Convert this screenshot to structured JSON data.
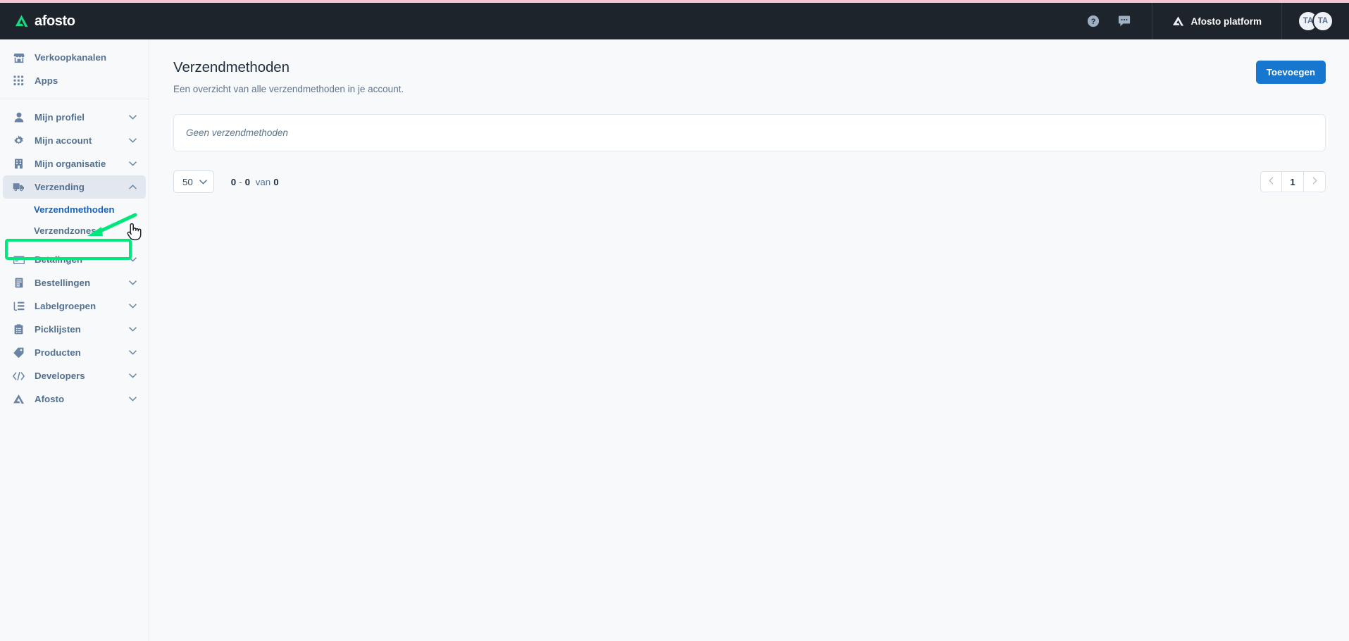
{
  "brand": {
    "name": "afosto",
    "logo_icon": "afosto-triangle-logo"
  },
  "header": {
    "help_icon": "question-circle-icon",
    "chat_icon": "chat-bubble-icon",
    "platform_icon": "afosto-triangle-icon",
    "platform_label": "Afosto platform",
    "avatars": [
      {
        "initials": "TA"
      },
      {
        "initials": "TA"
      }
    ]
  },
  "sidebar": {
    "top_items": [
      {
        "label": "Verkoopkanalen",
        "icon": "storefront-icon"
      },
      {
        "label": "Apps",
        "icon": "grid-apps-icon"
      }
    ],
    "items": [
      {
        "label": "Mijn profiel",
        "icon": "user-icon",
        "chevron": "chevron-down-icon"
      },
      {
        "label": "Mijn account",
        "icon": "gear-icon",
        "chevron": "chevron-down-icon"
      },
      {
        "label": "Mijn organisatie",
        "icon": "building-icon",
        "chevron": "chevron-down-icon"
      },
      {
        "label": "Verzending",
        "icon": "truck-icon",
        "chevron": "chevron-up-icon",
        "expanded": true
      },
      {
        "label": "Betalingen",
        "icon": "credit-card-icon",
        "chevron": "chevron-down-icon"
      },
      {
        "label": "Bestellingen",
        "icon": "receipt-icon",
        "chevron": "chevron-down-icon"
      },
      {
        "label": "Labelgroepen",
        "icon": "list-tree-icon",
        "chevron": "chevron-down-icon"
      },
      {
        "label": "Picklijsten",
        "icon": "clipboard-icon",
        "chevron": "chevron-down-icon"
      },
      {
        "label": "Producten",
        "icon": "tag-icon",
        "chevron": "chevron-down-icon"
      },
      {
        "label": "Developers",
        "icon": "code-icon",
        "chevron": "chevron-down-icon"
      },
      {
        "label": "Afosto",
        "icon": "afosto-triangle-icon",
        "chevron": "chevron-down-icon"
      }
    ],
    "verzending_subitems": [
      {
        "label": "Verzendmethoden",
        "selected": true
      },
      {
        "label": "Verzendzones",
        "selected": false
      }
    ]
  },
  "annotation": {
    "highlight_color": "#00e87b",
    "highlight_target": "Verzendmethoden",
    "cursor_icon": "pointing-hand-cursor",
    "arrow_icon": "green-arrow-icon"
  },
  "main": {
    "title": "Verzendmethoden",
    "subtitle": "Een overzicht van alle verzendmethoden in je account.",
    "add_button_label": "Toevoegen",
    "empty_message": "Geen verzendmethoden"
  },
  "footer": {
    "per_page_value": "50",
    "per_page_chevron": "chevron-down-icon",
    "count_from": "0",
    "count_dash": "-",
    "count_to": "0",
    "count_of_word": "van",
    "count_total": "0",
    "prev_icon": "chevron-left-icon",
    "next_icon": "chevron-right-icon",
    "current_page": "1"
  },
  "colors": {
    "header_bg": "#1d242c",
    "accent_strip": "#f6c6d4",
    "primary_button": "#1577cf",
    "sidebar_bg": "#f7f9fb",
    "link_blue": "#1564c0",
    "highlight_green": "#00e87b"
  }
}
